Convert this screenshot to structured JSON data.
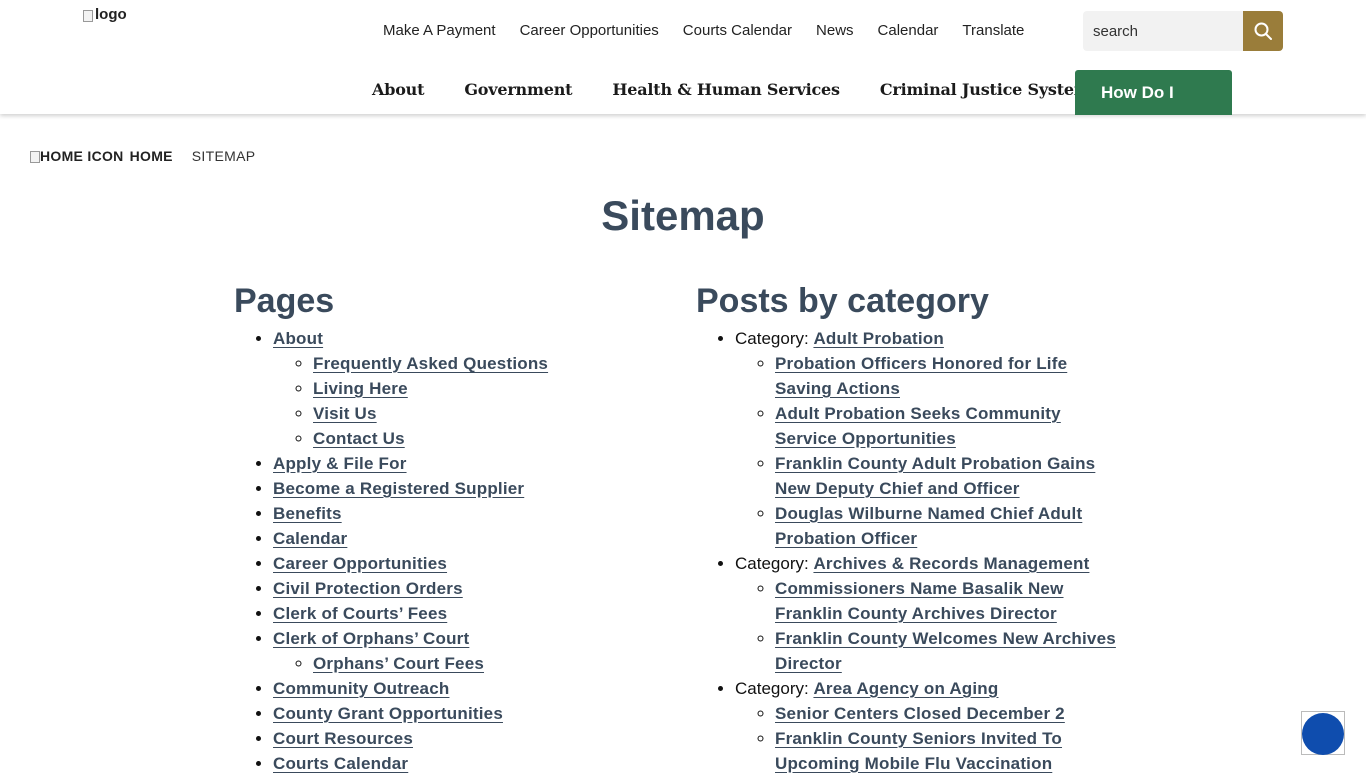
{
  "header": {
    "logo_alt": "logo",
    "utility_nav": [
      "Make A Payment",
      "Career Opportunities",
      "Courts Calendar",
      "News",
      "Calendar",
      "Translate"
    ],
    "search_placeholder": "search",
    "main_nav": [
      "About",
      "Government",
      "Health & Human Services",
      "Criminal Justice System"
    ],
    "how_do_i": "How Do I",
    "accent_gold": "#9a7d3a",
    "accent_green": "#2f7a4f"
  },
  "breadcrumb": {
    "home_icon_alt": "HOME ICON",
    "home": "HOME",
    "current": "SITEMAP"
  },
  "page_title": "Sitemap",
  "pages": {
    "heading": "Pages",
    "items": [
      {
        "label": "About",
        "children": [
          "Frequently Asked Questions",
          "Living Here",
          "Visit Us",
          "Contact Us"
        ]
      },
      {
        "label": "Apply & File For"
      },
      {
        "label": "Become a Registered Supplier"
      },
      {
        "label": "Benefits"
      },
      {
        "label": "Calendar"
      },
      {
        "label": "Career Opportunities"
      },
      {
        "label": "Civil Protection Orders"
      },
      {
        "label": "Clerk of Courts’ Fees"
      },
      {
        "label": "Clerk of Orphans’ Court",
        "children": [
          "Orphans’ Court Fees"
        ]
      },
      {
        "label": "Community Outreach"
      },
      {
        "label": "County Grant Opportunities"
      },
      {
        "label": "Court Resources"
      },
      {
        "label": "Courts Calendar"
      }
    ]
  },
  "posts": {
    "heading": "Posts by category",
    "category_prefix": "Category: ",
    "categories": [
      {
        "name": "Adult Probation",
        "posts": [
          "Probation Officers Honored for Life Saving Actions",
          "Adult Probation Seeks Community Service Opportunities",
          "Franklin County Adult Probation Gains New Deputy Chief and Officer",
          "Douglas Wilburne Named Chief Adult Probation Officer"
        ]
      },
      {
        "name": "Archives & Records Management",
        "posts": [
          "Commissioners Name Basalik New Franklin County Archives Director",
          "Franklin County Welcomes New Archives Director"
        ]
      },
      {
        "name": "Area Agency on Aging",
        "posts": [
          "Senior Centers Closed December 2",
          "Franklin County Seniors Invited To Upcoming Mobile Flu Vaccination"
        ]
      }
    ]
  },
  "link_color": "#3a4a5c"
}
